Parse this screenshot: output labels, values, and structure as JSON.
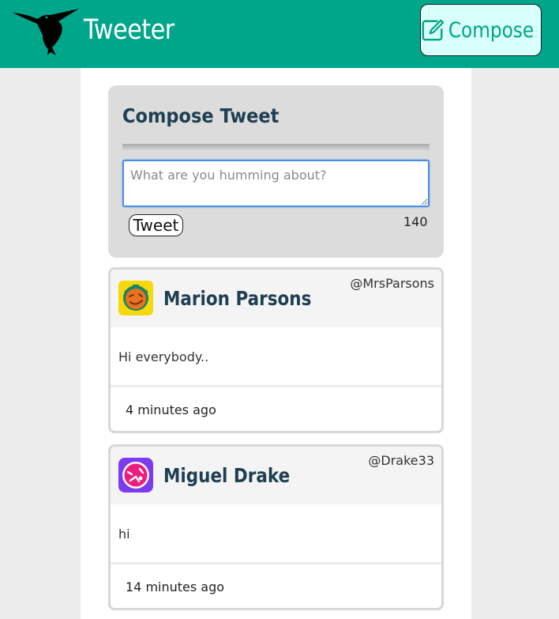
{
  "nav": {
    "brand": "Tweeter",
    "compose_label": "Compose",
    "logo_icon": "hummingbird-icon",
    "compose_icon": "edit-icon",
    "bar_color": "#00a689"
  },
  "compose": {
    "title": "Compose Tweet",
    "placeholder": "What are you humming about?",
    "tweet_button": "Tweet",
    "counter": "140"
  },
  "tweets": [
    {
      "name": "Marion Parsons",
      "handle": "@MrsParsons",
      "body": "Hi everybody..",
      "time": "4 minutes ago",
      "avatar_icon": "orange-face-avatar",
      "avatar_colors": {
        "bg": "#f5d90a",
        "face": "#e5731f",
        "ring": "#16836a"
      }
    },
    {
      "name": "Miguel Drake",
      "handle": "@Drake33",
      "body": "hi",
      "time": "14 minutes ago",
      "avatar_icon": "pink-face-avatar",
      "avatar_colors": {
        "bg": "#7b3cf0",
        "face": "#ee1c7c",
        "ring": "#ffffff"
      }
    }
  ]
}
